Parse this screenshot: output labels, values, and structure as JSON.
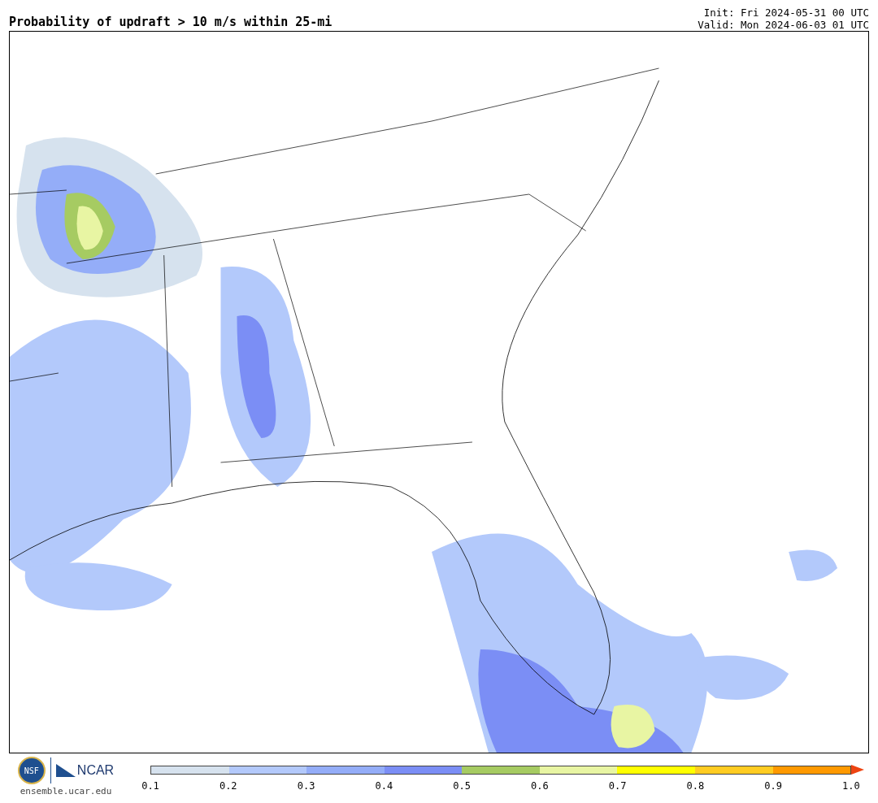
{
  "title": "Probability of updraft > 10 m/s within 25-mi",
  "init": "Init: Fri 2024-05-31 00 UTC",
  "valid": "Valid: Mon 2024-06-03 01 UTC",
  "logos": {
    "nsf": "NSF",
    "ncar": "NCAR",
    "url": "ensemble.ucar.edu"
  },
  "colorbar": {
    "bins": [
      {
        "kind": "bar",
        "color": "#d6e2ee"
      },
      {
        "kind": "bar",
        "color": "#b3c9fb"
      },
      {
        "kind": "bar",
        "color": "#94adf8"
      },
      {
        "kind": "bar",
        "color": "#7b8ef5"
      },
      {
        "kind": "bar",
        "color": "#a6cb62"
      },
      {
        "kind": "bar",
        "color": "#e8f5a3"
      },
      {
        "kind": "bar",
        "color": "#ffff00"
      },
      {
        "kind": "bar",
        "color": "#ffcc22"
      },
      {
        "kind": "bar",
        "color": "#ff9900"
      },
      {
        "kind": "arrow",
        "color": "#ee4411"
      }
    ],
    "ticks": [
      "0.1",
      "0.2",
      "0.3",
      "0.4",
      "0.5",
      "0.6",
      "0.7",
      "0.8",
      "0.9",
      "1.0"
    ]
  }
}
